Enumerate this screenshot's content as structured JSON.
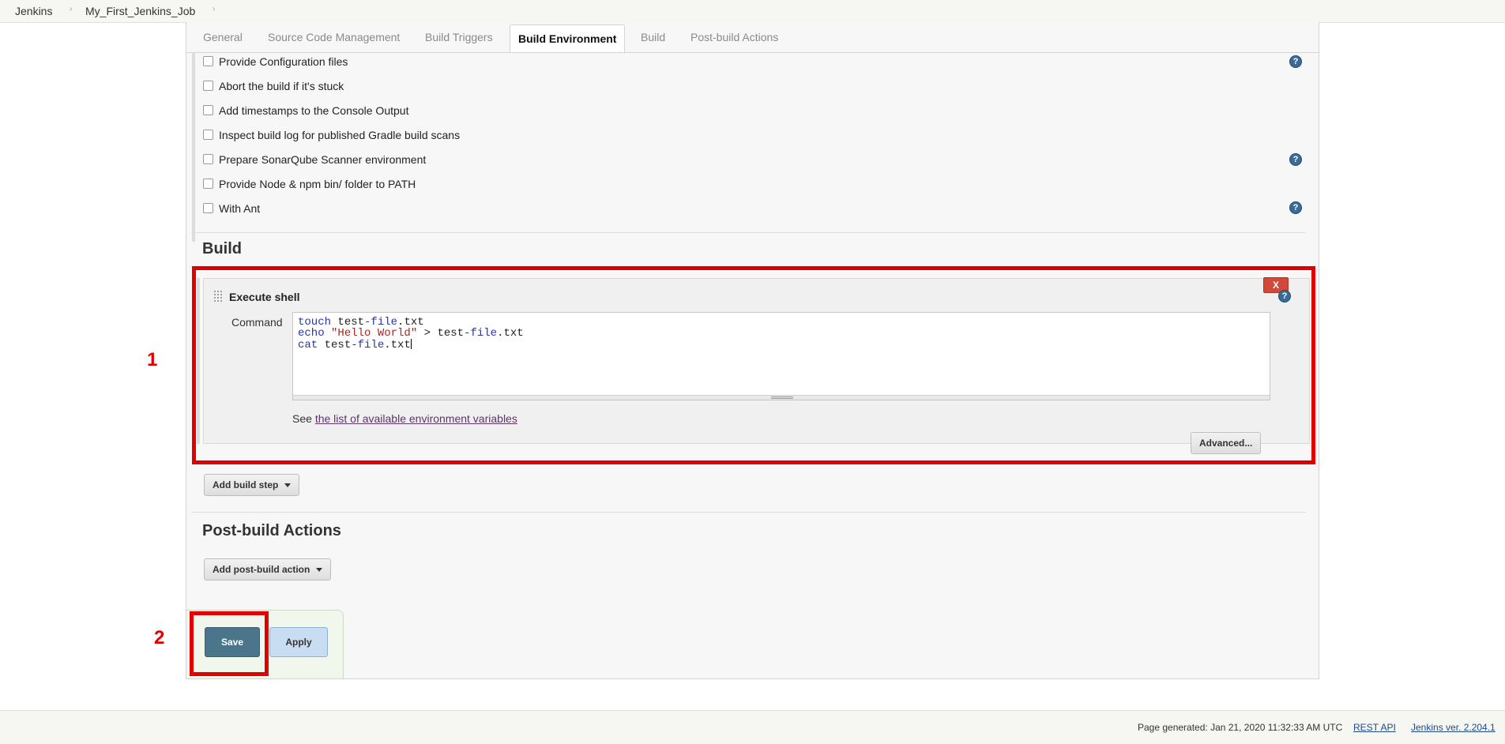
{
  "breadcrumb": {
    "items": [
      "Jenkins",
      "My_First_Jenkins_Job"
    ],
    "separator": "›"
  },
  "tabs": [
    {
      "label": "General"
    },
    {
      "label": "Source Code Management"
    },
    {
      "label": "Build Triggers"
    },
    {
      "label": "Build Environment",
      "active": true
    },
    {
      "label": "Build"
    },
    {
      "label": "Post-build Actions"
    }
  ],
  "build_environment": {
    "options": [
      {
        "label": "Provide Configuration files",
        "checked": false,
        "help": true
      },
      {
        "label": "Abort the build if it's stuck",
        "checked": false,
        "help": false
      },
      {
        "label": "Add timestamps to the Console Output",
        "checked": false,
        "help": false
      },
      {
        "label": "Inspect build log for published Gradle build scans",
        "checked": false,
        "help": false
      },
      {
        "label": "Prepare SonarQube Scanner environment",
        "checked": false,
        "help": true
      },
      {
        "label": "Provide Node & npm bin/ folder to PATH",
        "checked": false,
        "help": false
      },
      {
        "label": "With Ant",
        "checked": false,
        "help": true
      }
    ]
  },
  "build": {
    "title": "Build",
    "step": {
      "title": "Execute shell",
      "delete_label": "X",
      "command_label": "Command",
      "command_lines": [
        "touch test-file.txt",
        "echo \"Hello World\" > test-file.txt",
        "cat test-file.txt"
      ],
      "env_prefix": "See",
      "env_link": "the list of available environment variables",
      "advanced_label": "Advanced..."
    },
    "add_step_label": "Add build step"
  },
  "post_build": {
    "title": "Post-build Actions",
    "add_action_label": "Add post-build action"
  },
  "buttons": {
    "save": "Save",
    "apply": "Apply"
  },
  "annotations": {
    "one": "1",
    "two": "2"
  },
  "footer": {
    "generated": "Page generated: Jan 21, 2020 11:32:33 AM UTC",
    "rest_api": "REST API",
    "version": "Jenkins ver. 2.204.1"
  },
  "colors": {
    "annotation_red": "#e00000",
    "save_button": "#4b758b",
    "apply_button": "#c9ddf2",
    "help_icon": "#3a6a96"
  },
  "icons": {
    "help": "question-mark-circle-icon",
    "dropdown": "caret-down-icon",
    "drag": "drag-handle-icon"
  }
}
